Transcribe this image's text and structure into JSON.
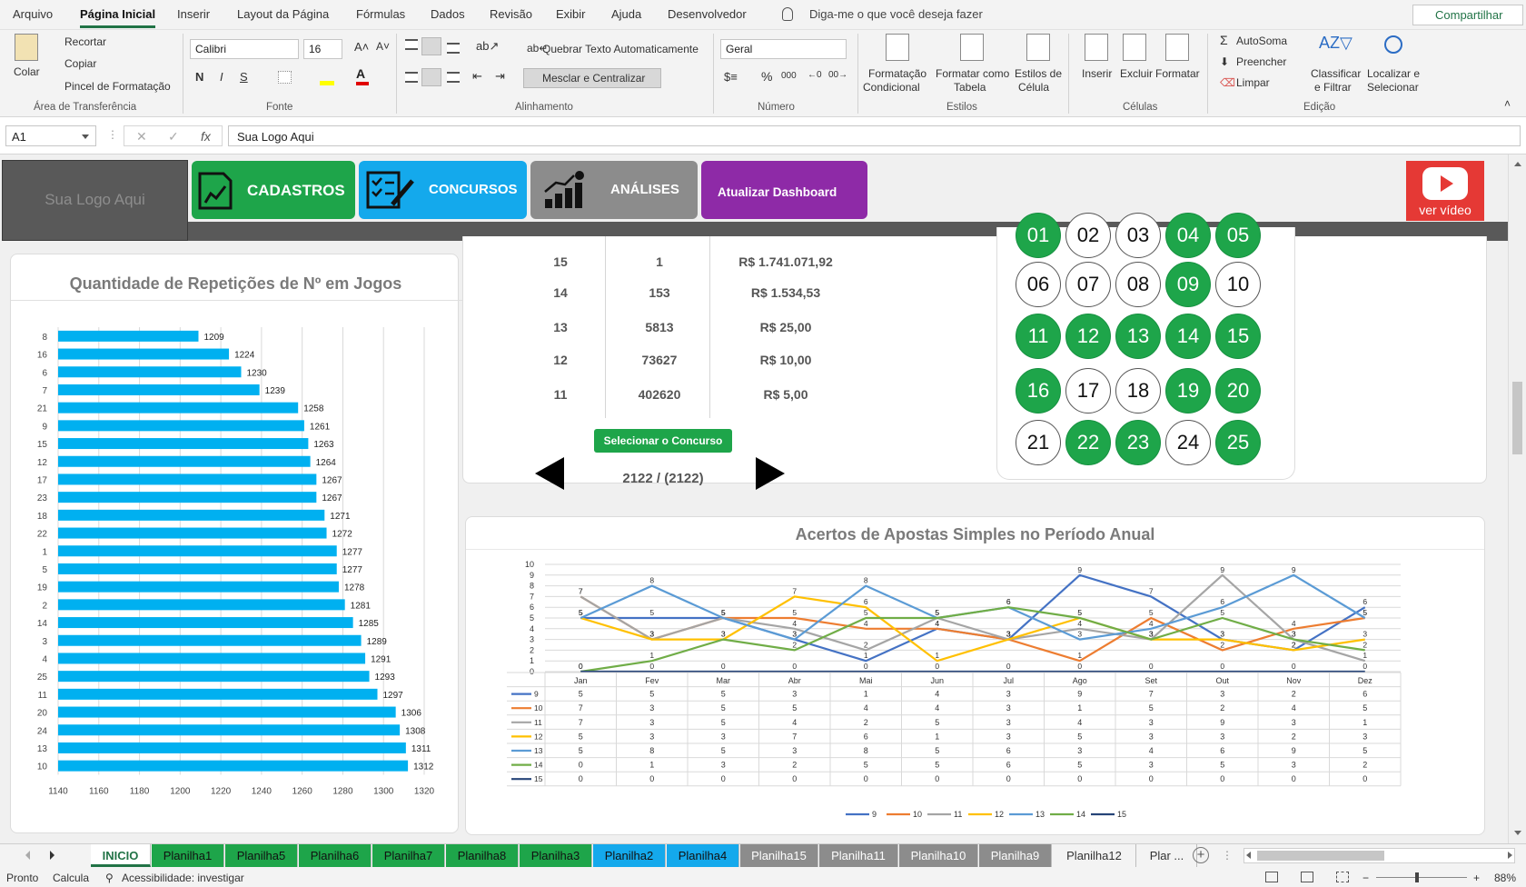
{
  "menu": {
    "tabs": [
      "Arquivo",
      "Página Inicial",
      "Inserir",
      "Layout da Página",
      "Fórmulas",
      "Dados",
      "Revisão",
      "Exibir",
      "Ajuda",
      "Desenvolvedor"
    ],
    "tell_me": "Diga-me o que você deseja fazer",
    "share": "Compartilhar"
  },
  "ribbon": {
    "clipboard": {
      "paste": "Colar",
      "cut": "Recortar",
      "copy": "Copiar",
      "format_painter": "Pincel de Formatação",
      "group": "Área de Transferência"
    },
    "font": {
      "name": "Calibri",
      "size": "16",
      "bold": "N",
      "italic": "I",
      "underline": "S",
      "group": "Fonte"
    },
    "alignment": {
      "wrap": "Quebrar Texto Automaticamente",
      "merge": "Mesclar e Centralizar",
      "group": "Alinhamento"
    },
    "number": {
      "format": "Geral",
      "percent": "%",
      "thousands": "000",
      "group": "Número"
    },
    "styles": {
      "conditional": [
        "Formatação",
        "Condicional"
      ],
      "table": [
        "Formatar como",
        "Tabela"
      ],
      "cell_styles": [
        "Estilos de",
        "Célula"
      ],
      "group": "Estilos"
    },
    "cells": {
      "insert": "Inserir",
      "delete": "Excluir",
      "format": "Formatar",
      "group": "Células"
    },
    "editing": {
      "autosum": "AutoSoma",
      "fill": "Preencher",
      "clear": "Limpar",
      "sort": [
        "Classificar",
        "e Filtrar"
      ],
      "find": [
        "Localizar e",
        "Selecionar"
      ],
      "group": "Edição"
    }
  },
  "formula_bar": {
    "name_box": "A1",
    "fx": "fx",
    "content": "Sua Logo Aqui"
  },
  "dashboard": {
    "logo_text": "Sua Logo Aqui",
    "nav": [
      {
        "label": "CADASTROS",
        "color": "#1ea54a"
      },
      {
        "label": "CONCURSOS",
        "color": "#14a9ec"
      },
      {
        "label": "ANÁLISES",
        "color": "#8c8c8c"
      },
      {
        "label": "Atualizar Dashboard",
        "color": "#8e2aa7"
      }
    ],
    "video_label": "ver vídeo",
    "prize_table": {
      "rows": [
        {
          "hits": "15",
          "winners": "1",
          "prize": "R$ 1.741.071,92"
        },
        {
          "hits": "14",
          "winners": "153",
          "prize": "R$ 1.534,53"
        },
        {
          "hits": "13",
          "winners": "5813",
          "prize": "R$ 25,00"
        },
        {
          "hits": "12",
          "winners": "73627",
          "prize": "R$ 10,00"
        },
        {
          "hits": "11",
          "winners": "402620",
          "prize": "R$ 5,00"
        }
      ],
      "select_button": "Selecionar o Concurso",
      "concurso": "2122 / (2122)"
    },
    "balls": [
      {
        "n": "01",
        "on": true
      },
      {
        "n": "02",
        "on": false
      },
      {
        "n": "03",
        "on": false
      },
      {
        "n": "04",
        "on": true
      },
      {
        "n": "05",
        "on": true
      },
      {
        "n": "06",
        "on": false
      },
      {
        "n": "07",
        "on": false
      },
      {
        "n": "08",
        "on": false
      },
      {
        "n": "09",
        "on": true
      },
      {
        "n": "10",
        "on": false
      },
      {
        "n": "11",
        "on": true
      },
      {
        "n": "12",
        "on": true
      },
      {
        "n": "13",
        "on": true
      },
      {
        "n": "14",
        "on": true
      },
      {
        "n": "15",
        "on": true
      },
      {
        "n": "16",
        "on": true
      },
      {
        "n": "17",
        "on": false
      },
      {
        "n": "18",
        "on": false
      },
      {
        "n": "19",
        "on": true
      },
      {
        "n": "20",
        "on": true
      },
      {
        "n": "21",
        "on": false
      },
      {
        "n": "22",
        "on": true
      },
      {
        "n": "23",
        "on": true
      },
      {
        "n": "24",
        "on": false
      },
      {
        "n": "25",
        "on": true
      }
    ]
  },
  "chart_data": [
    {
      "type": "bar",
      "title": "Quantidade de Repetições de Nº em Jogos",
      "categories": [
        "8",
        "16",
        "6",
        "7",
        "21",
        "9",
        "15",
        "12",
        "17",
        "23",
        "18",
        "22",
        "1",
        "5",
        "19",
        "2",
        "14",
        "3",
        "4",
        "25",
        "11",
        "20",
        "24",
        "13",
        "10"
      ],
      "values": [
        1209,
        1224,
        1230,
        1239,
        1258,
        1261,
        1263,
        1264,
        1267,
        1267,
        1271,
        1272,
        1277,
        1277,
        1278,
        1281,
        1285,
        1289,
        1291,
        1293,
        1297,
        1306,
        1308,
        1311,
        1312
      ],
      "xlim": [
        1140,
        1320
      ],
      "xticks": [
        1140,
        1160,
        1180,
        1200,
        1220,
        1240,
        1260,
        1280,
        1300,
        1320
      ],
      "color": "#00b0f0",
      "orientation": "horizontal",
      "grid": true
    },
    {
      "type": "line",
      "title": "Acertos de Apostas Simples no Período Anual",
      "categories": [
        "Jan",
        "Fev",
        "Mar",
        "Abr",
        "Mai",
        "Jun",
        "Jul",
        "Ago",
        "Set",
        "Out",
        "Nov",
        "Dez"
      ],
      "ylim": [
        0,
        10
      ],
      "yticks": [
        0,
        1,
        2,
        3,
        4,
        5,
        6,
        7,
        8,
        9,
        10
      ],
      "grid": true,
      "legend": "bottom",
      "data_table": true,
      "series": [
        {
          "name": "9",
          "color": "#4472c4",
          "values": [
            5,
            5,
            5,
            3,
            1,
            4,
            3,
            9,
            7,
            3,
            2,
            6
          ]
        },
        {
          "name": "10",
          "color": "#ed7d31",
          "values": [
            7,
            3,
            5,
            5,
            4,
            4,
            3,
            1,
            5,
            2,
            4,
            5
          ]
        },
        {
          "name": "11",
          "color": "#a5a5a5",
          "values": [
            7,
            3,
            5,
            4,
            2,
            5,
            3,
            4,
            3,
            9,
            3,
            1
          ]
        },
        {
          "name": "12",
          "color": "#ffc000",
          "values": [
            5,
            3,
            3,
            7,
            6,
            1,
            3,
            5,
            3,
            3,
            2,
            3
          ]
        },
        {
          "name": "13",
          "color": "#5b9bd5",
          "values": [
            5,
            8,
            5,
            3,
            8,
            5,
            6,
            3,
            4,
            6,
            9,
            5
          ]
        },
        {
          "name": "14",
          "color": "#70ad47",
          "values": [
            0,
            1,
            3,
            2,
            5,
            5,
            6,
            5,
            3,
            5,
            3,
            2
          ]
        },
        {
          "name": "15",
          "color": "#264478",
          "values": [
            0,
            0,
            0,
            0,
            0,
            0,
            0,
            0,
            0,
            0,
            0,
            0
          ]
        }
      ]
    }
  ],
  "sheet_tabs": [
    {
      "label": "INICIO",
      "bg": "#ffffff",
      "fg": "#217346",
      "active": true
    },
    {
      "label": "Planilha1",
      "bg": "#1ea54a",
      "fg": "#111111"
    },
    {
      "label": "Planilha5",
      "bg": "#1ea54a",
      "fg": "#111111"
    },
    {
      "label": "Planilha6",
      "bg": "#1ea54a",
      "fg": "#111111"
    },
    {
      "label": "Planilha7",
      "bg": "#1ea54a",
      "fg": "#111111"
    },
    {
      "label": "Planilha8",
      "bg": "#1ea54a",
      "fg": "#111111"
    },
    {
      "label": "Planilha3",
      "bg": "#1ea54a",
      "fg": "#111111"
    },
    {
      "label": "Planilha2",
      "bg": "#14a9ec",
      "fg": "#111111"
    },
    {
      "label": "Planilha4",
      "bg": "#14a9ec",
      "fg": "#111111"
    },
    {
      "label": "Planilha15",
      "bg": "#8c8c8c",
      "fg": "#ffffff"
    },
    {
      "label": "Planilha11",
      "bg": "#8c8c8c",
      "fg": "#ffffff"
    },
    {
      "label": "Planilha10",
      "bg": "#8c8c8c",
      "fg": "#ffffff"
    },
    {
      "label": "Planilha9",
      "bg": "#8c8c8c",
      "fg": "#ffffff"
    },
    {
      "label": "Planilha12",
      "bg": "#f3f3f3",
      "fg": "#333333"
    },
    {
      "label": "Plar ...",
      "bg": "#f3f3f3",
      "fg": "#333333"
    }
  ],
  "status": {
    "ready": "Pronto",
    "calc": "Calcula",
    "accessibility": "Acessibilidade: investigar",
    "zoom": "88%"
  }
}
